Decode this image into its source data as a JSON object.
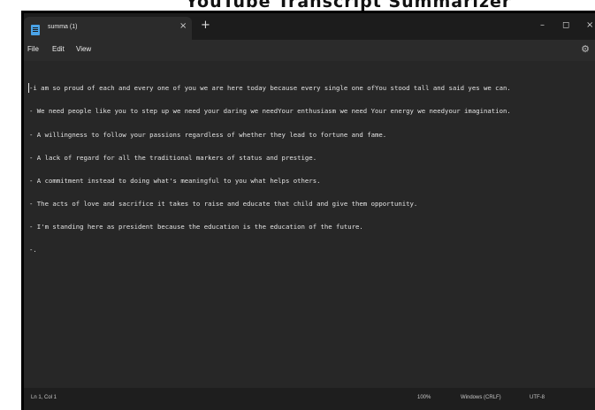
{
  "background_title": "YouTube Transcript Summarizer",
  "window": {
    "tab_title": "summa (1)",
    "new_tab": "+",
    "tab_close": "×",
    "minimize": "–",
    "maximize": "◻",
    "close": "×"
  },
  "menu": {
    "file": "File",
    "edit": "Edit",
    "view": "View"
  },
  "editor": {
    "lines": [
      "-i am so proud of each and every one of you we are here today because every single one ofYou stood tall and said yes we can.",
      "- We need people like you to step up we need your daring we needYour enthusiasm we need Your energy we needyour imagination.",
      "- A willingness to follow your passions regardless of whether they lead to fortune and fame.",
      "- A lack of regard for all the traditional markers of status and prestige.",
      "- A commitment instead to doing what's meaningful to you what helps others.",
      "- The acts of love and sacrifice it takes to raise and educate that child and give them opportunity.",
      "- I'm standing here as president because the education is the education of the future.",
      "-."
    ]
  },
  "status": {
    "position": "Ln 1, Col 1",
    "zoom": "100%",
    "line_ending": "Windows (CRLF)",
    "encoding": "UTF-8"
  },
  "colors": {
    "accent": "#4aa3e8",
    "editor_bg": "#272727",
    "titlebar_bg": "#1c1c1c"
  }
}
